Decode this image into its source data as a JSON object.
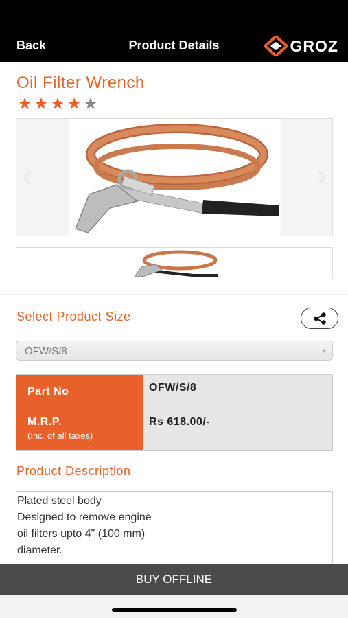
{
  "nav": {
    "back_label": "Back",
    "title": "Product Details",
    "logo_text": "GROZ"
  },
  "product": {
    "name": "Oil Filter Wrench",
    "rating": 4,
    "rating_max": 5
  },
  "size_section": {
    "title": "Select Product Size",
    "selected_size": "OFW/S/8"
  },
  "specs": {
    "part_no_label": "Part No",
    "part_no_value": "OFW/S/8",
    "mrp_label": "M.R.P.",
    "mrp_sublabel": "(Inc. of all taxes)",
    "mrp_value": "Rs 618.00/-"
  },
  "description": {
    "title": "Product Description",
    "lines": [
      "Plated steel body",
      "Designed to remove engine",
      "oil filters upto 4\" (100 mm)",
      "diameter."
    ]
  },
  "footer": {
    "buy_label": "BUY OFFLINE"
  },
  "colors": {
    "brand_orange": "#e0662c",
    "star_filled": "#e8612a",
    "star_empty": "#888888",
    "nav_bg": "#000000"
  },
  "icons": {
    "share": "share-icon",
    "dropdown": "chevron-down-icon",
    "logo": "groz-logo-icon"
  }
}
